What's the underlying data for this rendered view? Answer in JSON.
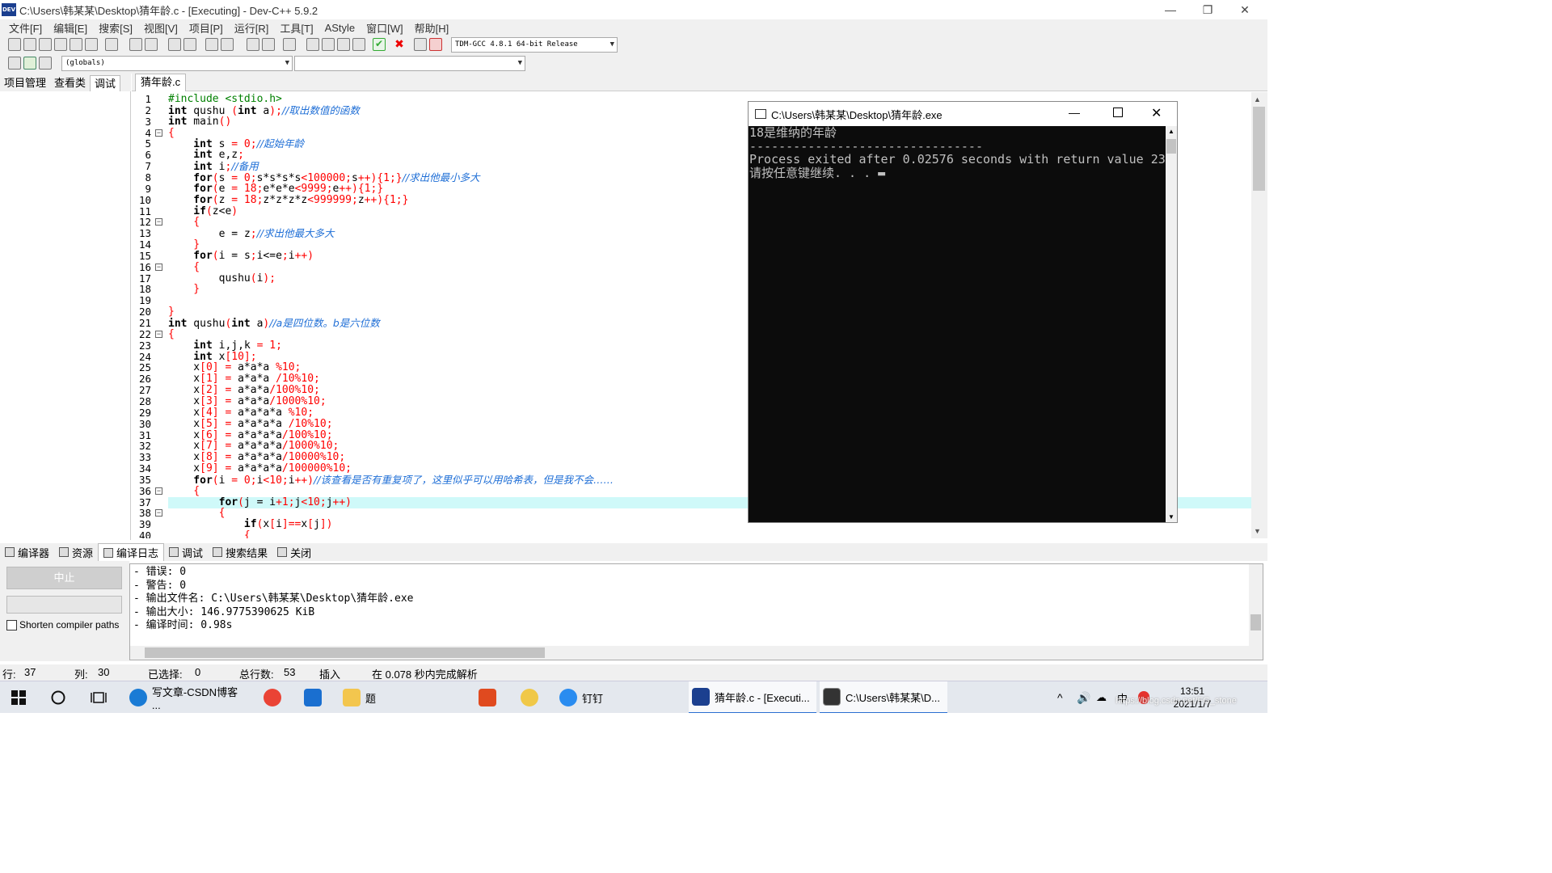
{
  "window": {
    "title": "C:\\Users\\韩某某\\Desktop\\猜年龄.c - [Executing] - Dev-C++ 5.9.2",
    "logo": "DEV",
    "controls": [
      "—",
      "❐",
      "✕"
    ]
  },
  "menu": [
    "文件[F]",
    "编辑[E]",
    "搜索[S]",
    "视图[V]",
    "项目[P]",
    "运行[R]",
    "工具[T]",
    "AStyle",
    "窗口[W]",
    "帮助[H]"
  ],
  "toolbar": {
    "compiler_select": "TDM-GCC 4.8.1 64-bit Release",
    "scope_select": "(globals)",
    "function_select": ""
  },
  "left_tabs": [
    "项目管理",
    "查看类",
    "调试"
  ],
  "editor": {
    "file_tab": "猜年龄.c",
    "current_line": 37,
    "lines": [
      {
        "n": "1",
        "segs": [
          [
            "#include <stdio.h>",
            "#008000"
          ]
        ]
      },
      {
        "n": "2",
        "segs": [
          [
            "int",
            "#000",
            "b"
          ],
          [
            " qushu ",
            "#000"
          ],
          [
            "(",
            "#f00"
          ],
          [
            "int",
            "#000",
            "b"
          ],
          [
            " a",
            ""
          ],
          [
            ");",
            "#f00"
          ],
          [
            "//取出数值的函数",
            "#1e6ed6",
            "i"
          ]
        ]
      },
      {
        "n": "3",
        "segs": [
          [
            "int",
            "#000",
            "b"
          ],
          [
            " main",
            ""
          ],
          [
            "()",
            "#f00"
          ]
        ]
      },
      {
        "n": "4",
        "fold": "-",
        "segs": [
          [
            "{",
            "#f00"
          ]
        ]
      },
      {
        "n": "5",
        "segs": [
          [
            "    int",
            "#000",
            "b"
          ],
          [
            " s ",
            ""
          ],
          [
            "= 0;",
            "#f00"
          ],
          [
            "//起始年龄",
            "#1e6ed6",
            "i"
          ]
        ]
      },
      {
        "n": "6",
        "segs": [
          [
            "    int",
            "#000",
            "b"
          ],
          [
            " e",
            ""
          ],
          [
            ",",
            ""
          ],
          [
            "z",
            ""
          ],
          [
            ";",
            "#f00"
          ]
        ]
      },
      {
        "n": "7",
        "segs": [
          [
            "    int",
            "#000",
            "b"
          ],
          [
            " i",
            ""
          ],
          [
            ";",
            "#f00"
          ],
          [
            "//备用",
            "#1e6ed6",
            "i"
          ]
        ]
      },
      {
        "n": "8",
        "segs": [
          [
            "    for",
            "#000",
            "b"
          ],
          [
            "(",
            "#f00"
          ],
          [
            "s ",
            ""
          ],
          [
            "= 0;",
            "#f00"
          ],
          [
            "s*s*s*s",
            ""
          ],
          [
            "<100000;",
            "#f00"
          ],
          [
            "s",
            ""
          ],
          [
            "++){1;}",
            "#f00"
          ],
          [
            "//求出他最小多大",
            "#1e6ed6",
            "i"
          ]
        ]
      },
      {
        "n": "9",
        "segs": [
          [
            "    for",
            "#000",
            "b"
          ],
          [
            "(",
            "#f00"
          ],
          [
            "e ",
            ""
          ],
          [
            "= 18;",
            "#f00"
          ],
          [
            "e*e*e",
            ""
          ],
          [
            "<9999;",
            "#f00"
          ],
          [
            "e",
            ""
          ],
          [
            "++){1;}",
            "#f00"
          ]
        ]
      },
      {
        "n": "10",
        "segs": [
          [
            "    for",
            "#000",
            "b"
          ],
          [
            "(",
            "#f00"
          ],
          [
            "z ",
            ""
          ],
          [
            "= 18;",
            "#f00"
          ],
          [
            "z*z*z*z",
            ""
          ],
          [
            "<999999;",
            "#f00"
          ],
          [
            "z",
            ""
          ],
          [
            "++){1;}",
            "#f00"
          ]
        ]
      },
      {
        "n": "11",
        "segs": [
          [
            "    if",
            "#000",
            "b"
          ],
          [
            "(",
            "#f00"
          ],
          [
            "z",
            ""
          ],
          [
            "<",
            ""
          ],
          [
            "e",
            ""
          ],
          [
            ")",
            "#f00"
          ]
        ]
      },
      {
        "n": "12",
        "fold": "-",
        "segs": [
          [
            "    {",
            "#f00"
          ]
        ]
      },
      {
        "n": "13",
        "segs": [
          [
            "        e ",
            ""
          ],
          [
            "= ",
            ""
          ],
          [
            "z",
            ""
          ],
          [
            ";",
            "#f00"
          ],
          [
            "//求出他最大多大",
            "#1e6ed6",
            "i"
          ]
        ]
      },
      {
        "n": "14",
        "segs": [
          [
            "    }",
            "#f00"
          ]
        ]
      },
      {
        "n": "15",
        "segs": [
          [
            "    for",
            "#000",
            "b"
          ],
          [
            "(",
            "#f00"
          ],
          [
            "i ",
            ""
          ],
          [
            "= ",
            ""
          ],
          [
            "s",
            ""
          ],
          [
            ";",
            "#f00"
          ],
          [
            "i",
            ""
          ],
          [
            "<=",
            ""
          ],
          [
            "e",
            ""
          ],
          [
            ";",
            "#f00"
          ],
          [
            "i",
            ""
          ],
          [
            "++)",
            "#f00"
          ]
        ]
      },
      {
        "n": "16",
        "fold": "-",
        "segs": [
          [
            "    {",
            "#f00"
          ]
        ]
      },
      {
        "n": "17",
        "segs": [
          [
            "        qushu",
            ""
          ],
          [
            "(",
            "#f00"
          ],
          [
            "i",
            ""
          ],
          [
            ");",
            "#f00"
          ]
        ]
      },
      {
        "n": "18",
        "segs": [
          [
            "    }",
            "#f00"
          ]
        ]
      },
      {
        "n": "19",
        "segs": [
          [
            "",
            ""
          ]
        ]
      },
      {
        "n": "20",
        "segs": [
          [
            "}",
            "#f00"
          ]
        ]
      },
      {
        "n": "21",
        "segs": [
          [
            "int",
            "#000",
            "b"
          ],
          [
            " qushu",
            ""
          ],
          [
            "(",
            "#f00"
          ],
          [
            "int",
            "#000",
            "b"
          ],
          [
            " a",
            ""
          ],
          [
            ")",
            "#f00"
          ],
          [
            "//a是四位数。b是六位数",
            "#1e6ed6",
            "i"
          ]
        ]
      },
      {
        "n": "22",
        "fold": "-",
        "segs": [
          [
            "{",
            "#f00"
          ]
        ]
      },
      {
        "n": "23",
        "segs": [
          [
            "    int",
            "#000",
            "b"
          ],
          [
            " i",
            ""
          ],
          [
            ",",
            ""
          ],
          [
            "j",
            ""
          ],
          [
            ",",
            ""
          ],
          [
            "k ",
            ""
          ],
          [
            "= 1;",
            "#f00"
          ]
        ]
      },
      {
        "n": "24",
        "segs": [
          [
            "    int",
            "#000",
            "b"
          ],
          [
            " x",
            ""
          ],
          [
            "[10];",
            "#f00"
          ]
        ]
      },
      {
        "n": "25",
        "segs": [
          [
            "    x",
            ""
          ],
          [
            "[0] ",
            "#f00"
          ],
          [
            "= ",
            "#f00"
          ],
          [
            "a*a*a ",
            ""
          ],
          [
            "%10;",
            "#f00"
          ]
        ]
      },
      {
        "n": "26",
        "segs": [
          [
            "    x",
            ""
          ],
          [
            "[1] ",
            "#f00"
          ],
          [
            "= ",
            "#f00"
          ],
          [
            "a*a*a ",
            ""
          ],
          [
            "/10%10;",
            "#f00"
          ]
        ]
      },
      {
        "n": "27",
        "segs": [
          [
            "    x",
            ""
          ],
          [
            "[2] ",
            "#f00"
          ],
          [
            "= ",
            "#f00"
          ],
          [
            "a*a*a",
            ""
          ],
          [
            "/100%10;",
            "#f00"
          ]
        ]
      },
      {
        "n": "28",
        "segs": [
          [
            "    x",
            ""
          ],
          [
            "[3] ",
            "#f00"
          ],
          [
            "= ",
            "#f00"
          ],
          [
            "a*a*a",
            ""
          ],
          [
            "/1000%10;",
            "#f00"
          ]
        ]
      },
      {
        "n": "29",
        "segs": [
          [
            "    x",
            ""
          ],
          [
            "[4] ",
            "#f00"
          ],
          [
            "= ",
            "#f00"
          ],
          [
            "a*a*a*a ",
            ""
          ],
          [
            "%10;",
            "#f00"
          ]
        ]
      },
      {
        "n": "30",
        "segs": [
          [
            "    x",
            ""
          ],
          [
            "[5] ",
            "#f00"
          ],
          [
            "= ",
            "#f00"
          ],
          [
            "a*a*a*a ",
            ""
          ],
          [
            "/10%10;",
            "#f00"
          ]
        ]
      },
      {
        "n": "31",
        "segs": [
          [
            "    x",
            ""
          ],
          [
            "[6] ",
            "#f00"
          ],
          [
            "= ",
            "#f00"
          ],
          [
            "a*a*a*a",
            ""
          ],
          [
            "/100%10;",
            "#f00"
          ]
        ]
      },
      {
        "n": "32",
        "segs": [
          [
            "    x",
            ""
          ],
          [
            "[7] ",
            "#f00"
          ],
          [
            "= ",
            "#f00"
          ],
          [
            "a*a*a*a",
            ""
          ],
          [
            "/1000%10;",
            "#f00"
          ]
        ]
      },
      {
        "n": "33",
        "segs": [
          [
            "    x",
            ""
          ],
          [
            "[8] ",
            "#f00"
          ],
          [
            "= ",
            "#f00"
          ],
          [
            "a*a*a*a",
            ""
          ],
          [
            "/10000%10;",
            "#f00"
          ]
        ]
      },
      {
        "n": "34",
        "segs": [
          [
            "    x",
            ""
          ],
          [
            "[9] ",
            "#f00"
          ],
          [
            "= ",
            "#f00"
          ],
          [
            "a*a*a*a",
            ""
          ],
          [
            "/100000%10;",
            "#f00"
          ]
        ]
      },
      {
        "n": "35",
        "segs": [
          [
            "    for",
            "#000",
            "b"
          ],
          [
            "(",
            "#f00"
          ],
          [
            "i ",
            ""
          ],
          [
            "= 0;",
            "#f00"
          ],
          [
            "i",
            ""
          ],
          [
            "<10;",
            "#f00"
          ],
          [
            "i",
            ""
          ],
          [
            "++)",
            "#f00"
          ],
          [
            "//该查看是否有重复项了，这里似乎可以用哈希表，但是我不会……",
            "#1e6ed6",
            "i"
          ]
        ]
      },
      {
        "n": "36",
        "fold": "-",
        "segs": [
          [
            "    {",
            "#f00"
          ]
        ]
      },
      {
        "n": "37",
        "segs": [
          [
            "        for",
            "#000",
            "b"
          ],
          [
            "(",
            "#f00"
          ],
          [
            "j ",
            ""
          ],
          [
            "= ",
            ""
          ],
          [
            "i",
            ""
          ],
          [
            "+1;",
            "#f00"
          ],
          [
            "j",
            ""
          ],
          [
            "<10;",
            "#f00"
          ],
          [
            "j",
            ""
          ],
          [
            "++)",
            "#f00"
          ]
        ]
      },
      {
        "n": "38",
        "fold": "-",
        "segs": [
          [
            "        {",
            "#f00"
          ]
        ]
      },
      {
        "n": "39",
        "segs": [
          [
            "            if",
            "#000",
            "b"
          ],
          [
            "(",
            "#f00"
          ],
          [
            "x",
            ""
          ],
          [
            "[",
            "#f00"
          ],
          [
            "i",
            ""
          ],
          [
            "]==",
            "#f00"
          ],
          [
            "x",
            ""
          ],
          [
            "[",
            "#f00"
          ],
          [
            "j",
            ""
          ],
          [
            "])",
            "#f00"
          ]
        ]
      },
      {
        "n": "40",
        "segs": [
          [
            "            {",
            "#f00"
          ]
        ]
      }
    ]
  },
  "console": {
    "title": "C:\\Users\\韩某某\\Desktop\\猜年龄.exe",
    "lines": [
      "18是维纳的年龄",
      "--------------------------------",
      "Process exited after 0.02576 seconds with return value 23",
      "请按任意键继续. . . ▬"
    ]
  },
  "bottom_tabs": [
    "编译器",
    "资源",
    "编译日志",
    "调试",
    "搜索结果",
    "关闭"
  ],
  "bottom_left": {
    "stop_button": "中止",
    "shorten_label": "Shorten compiler paths"
  },
  "log": [
    "- 错误: 0",
    "- 警告: 0",
    "- 输出文件名: C:\\Users\\韩某某\\Desktop\\猜年龄.exe",
    "- 输出大小: 146.9775390625 KiB",
    "- 编译时间: 0.98s"
  ],
  "status": {
    "row_label": "行:",
    "row_value": "37",
    "col_label": "列:",
    "col_value": "30",
    "sel_label": "已选择:",
    "sel_value": "0",
    "total_label": "总行数:",
    "total_value": "53",
    "mode": "插入",
    "parse": "在 0.078 秒内完成解析"
  },
  "taskbar": {
    "items": [
      "写文章-CSDN博客 ...",
      "题",
      "钉钉",
      "猜年龄.c - [Executi...",
      "C:\\Users\\韩某某\\D..."
    ],
    "time": "13:51",
    "date": "2021/1/7",
    "watermark": "https://blog.csdn.net/FG_stone"
  }
}
